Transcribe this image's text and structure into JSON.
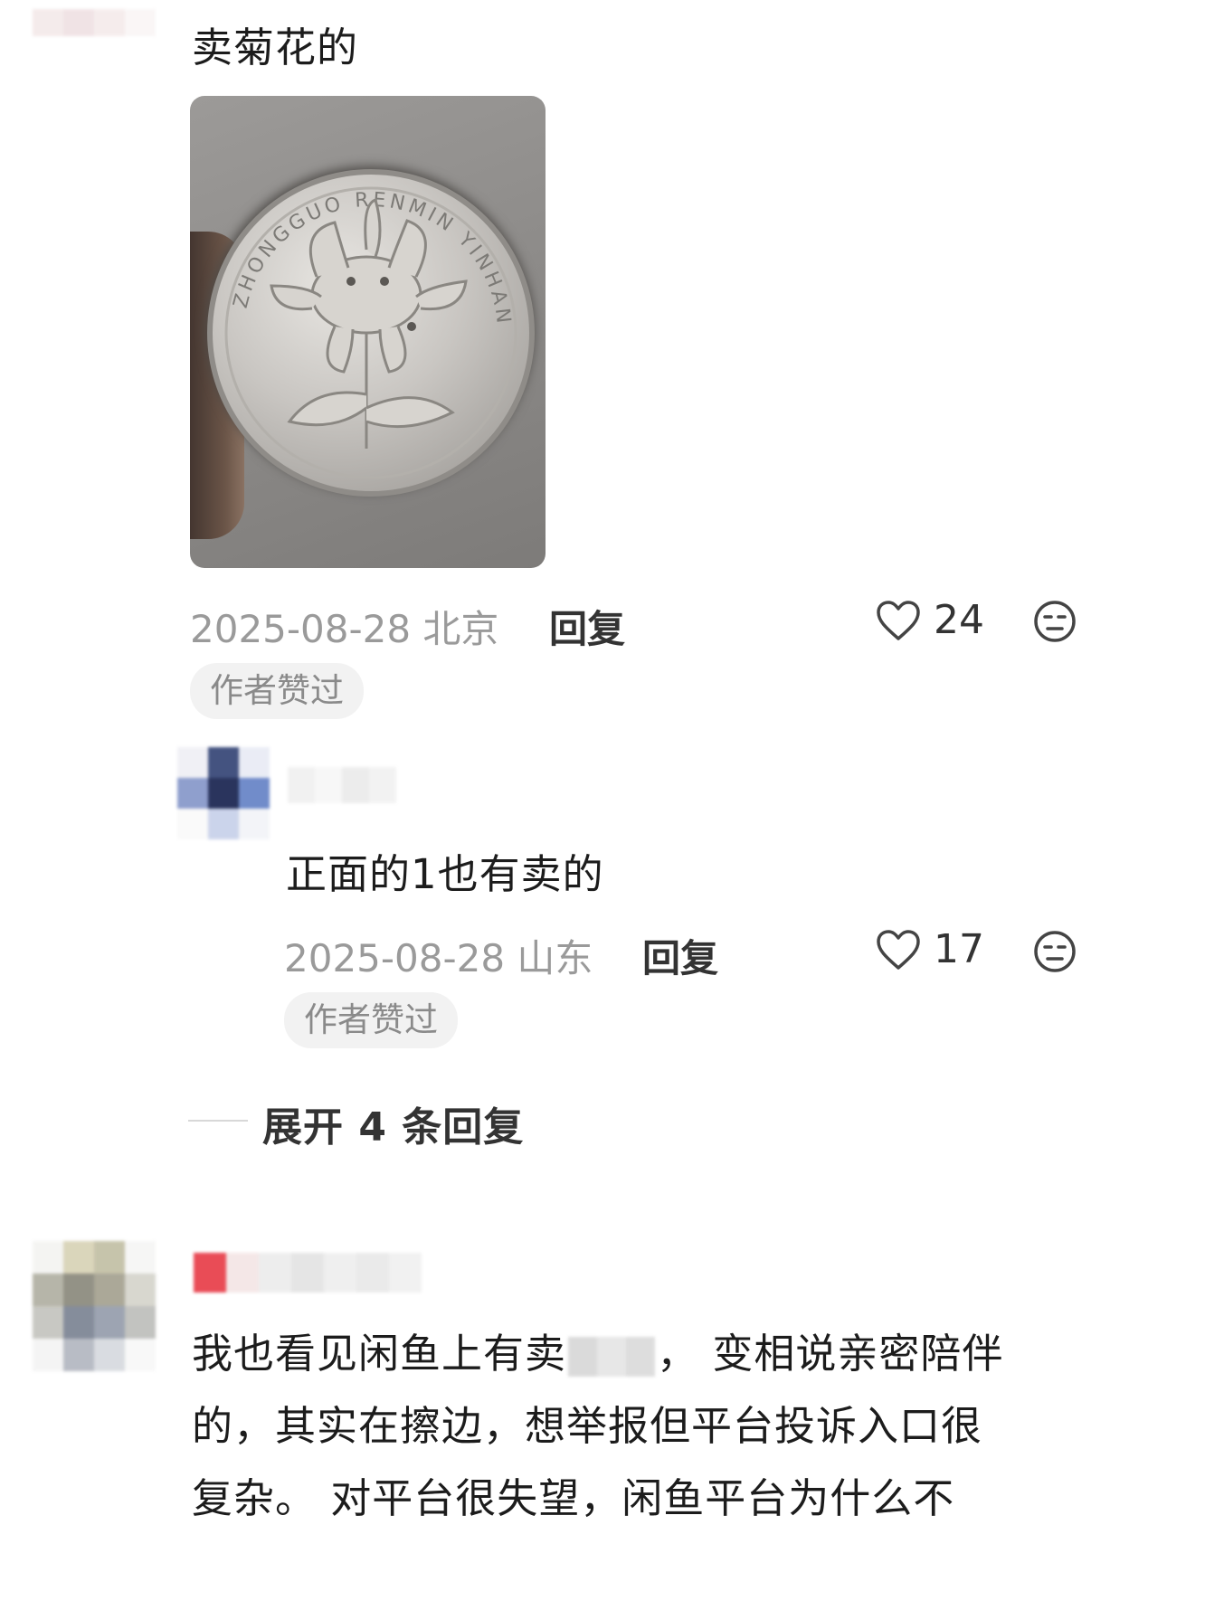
{
  "comment1": {
    "text": "卖菊花的",
    "date": "2025-08-28 北京",
    "reply_label": "回复",
    "likes": "24",
    "badge": "作者赞过"
  },
  "coin": {
    "inscription": "ZHONGGUO RENMIN YINHANG"
  },
  "reply1": {
    "text": "正面的1也有卖的",
    "date": "2025-08-28 山东",
    "reply_label": "回复",
    "likes": "17",
    "badge": "作者赞过"
  },
  "expand": {
    "label": "展开 4 条回复"
  },
  "comment2": {
    "line1": "我也看见闲鱼上有卖",
    "line1_end": "， 变相说亲密陪伴",
    "line2": "的，其实在擦边，想举报但平台投诉入口很",
    "line3": "复杂。 对平台很失望，闲鱼平台为什么不"
  },
  "icons": {
    "like": "heart-outline-icon",
    "emoji": "neutral-face-icon"
  }
}
